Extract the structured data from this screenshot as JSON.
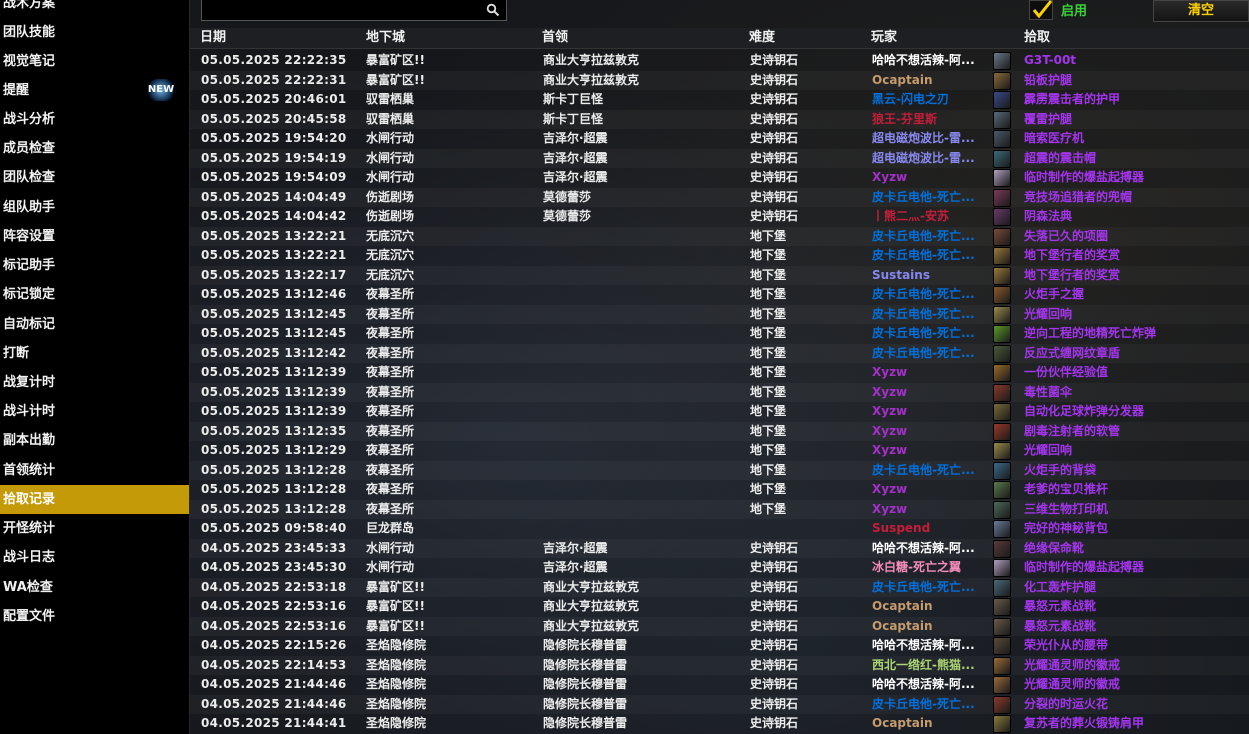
{
  "sidebar": {
    "items": [
      {
        "label": "战术方案"
      },
      {
        "label": "团队技能"
      },
      {
        "label": "视觉笔记"
      },
      {
        "label": "提醒",
        "badge": "NEW"
      },
      {
        "label": "战斗分析"
      },
      {
        "label": "成员检查"
      },
      {
        "label": "团队检查"
      },
      {
        "label": "组队助手"
      },
      {
        "label": "阵容设置"
      },
      {
        "label": "标记助手"
      },
      {
        "label": "标记锁定"
      },
      {
        "label": "自动标记"
      },
      {
        "label": "打断"
      },
      {
        "label": "战复计时"
      },
      {
        "label": "战斗计时"
      },
      {
        "label": "副本出勤"
      },
      {
        "label": "首领统计"
      },
      {
        "label": "拾取记录",
        "active": true
      },
      {
        "label": "开怪统计"
      },
      {
        "label": "战斗日志"
      },
      {
        "label": "WA检查"
      },
      {
        "label": "配置文件"
      }
    ]
  },
  "toolbar": {
    "search_value": "",
    "enable_label": "启用",
    "enabled": true,
    "clear_label": "清空"
  },
  "table": {
    "headers": [
      "日期",
      "地下城",
      "首领",
      "难度",
      "玩家",
      "拾取"
    ],
    "rows": [
      {
        "date": "05.05.2025 22:22:35",
        "dungeon": "暴富矿区!!",
        "boss": "商业大亨拉兹敦克",
        "difficulty": "史诗钥石",
        "player": "哈哈不想活辣-阿...",
        "player_color": "#ffffff",
        "icon_color": "#6b7a8a",
        "loot": "G3T-00t",
        "loot_color": "#a335ee"
      },
      {
        "date": "05.05.2025 22:22:31",
        "dungeon": "暴富矿区!!",
        "boss": "商业大亨拉兹敦克",
        "difficulty": "史诗钥石",
        "player": "Ocaptain",
        "player_color": "#c69b6d",
        "icon_color": "#8a6a3a",
        "loot": "铅板护腿",
        "loot_color": "#a335ee"
      },
      {
        "date": "05.05.2025 20:46:01",
        "dungeon": "驭雷栖巢",
        "boss": "斯卡丁巨怪",
        "difficulty": "史诗钥石",
        "player": "黑云-闪电之刃",
        "player_color": "#0070dd",
        "icon_color": "#3a4a8a",
        "loot": "霹雳震击者的护甲",
        "loot_color": "#a335ee"
      },
      {
        "date": "05.05.2025 20:45:58",
        "dungeon": "驭雷栖巢",
        "boss": "斯卡丁巨怪",
        "difficulty": "史诗钥石",
        "player": "狼王-芬里斯",
        "player_color": "#c41e3a",
        "icon_color": "#5a6a7a",
        "loot": "覆雷护腿",
        "loot_color": "#a335ee"
      },
      {
        "date": "05.05.2025 19:54:20",
        "dungeon": "水闸行动",
        "boss": "吉泽尔·超震",
        "difficulty": "史诗钥石",
        "player": "超电磁炮波比-雷...",
        "player_color": "#8788ee",
        "icon_color": "#4a5a6a",
        "loot": "暗索医疗机",
        "loot_color": "#a335ee"
      },
      {
        "date": "05.05.2025 19:54:19",
        "dungeon": "水闸行动",
        "boss": "吉泽尔·超震",
        "difficulty": "史诗钥石",
        "player": "超电磁炮波比-雷...",
        "player_color": "#8788ee",
        "icon_color": "#3a6a7a",
        "loot": "超震的震击帽",
        "loot_color": "#a335ee"
      },
      {
        "date": "05.05.2025 19:54:09",
        "dungeon": "水闸行动",
        "boss": "吉泽尔·超震",
        "difficulty": "史诗钥石",
        "player": "Xyzw",
        "player_color": "#a330c9",
        "icon_color": "#b0a0c0",
        "loot": "临时制作的爆盐起搏器",
        "loot_color": "#a335ee"
      },
      {
        "date": "05.05.2025 14:04:49",
        "dungeon": "伤逝剧场",
        "boss": "莫德蕾莎",
        "difficulty": "史诗钥石",
        "player": "皮卡丘电他-死亡...",
        "player_color": "#0070dd",
        "icon_color": "#7a3a5a",
        "loot": "竞技场追猎者的兜帽",
        "loot_color": "#a335ee"
      },
      {
        "date": "05.05.2025 14:04:42",
        "dungeon": "伤逝剧场",
        "boss": "莫德蕾莎",
        "difficulty": "史诗钥石",
        "player": "丨熊二灬-安苏",
        "player_color": "#c41e3a",
        "icon_color": "#6a3a6a",
        "loot": "阴森法典",
        "loot_color": "#a335ee"
      },
      {
        "date": "05.05.2025 13:22:21",
        "dungeon": "无底沉穴",
        "boss": "",
        "difficulty": "地下堡",
        "player": "皮卡丘电他-死亡...",
        "player_color": "#0070dd",
        "icon_color": "#7a4a3a",
        "loot": "失落已久的项圈",
        "loot_color": "#a335ee"
      },
      {
        "date": "05.05.2025 13:22:21",
        "dungeon": "无底沉穴",
        "boss": "",
        "difficulty": "地下堡",
        "player": "皮卡丘电他-死亡...",
        "player_color": "#0070dd",
        "icon_color": "#9a7a3a",
        "loot": "地下堡行者的奖赏",
        "loot_color": "#a335ee"
      },
      {
        "date": "05.05.2025 13:22:17",
        "dungeon": "无底沉穴",
        "boss": "",
        "difficulty": "地下堡",
        "player": "Sustains",
        "player_color": "#8788ee",
        "icon_color": "#9a7a3a",
        "loot": "地下堡行者的奖赏",
        "loot_color": "#a335ee"
      },
      {
        "date": "05.05.2025 13:12:46",
        "dungeon": "夜幕圣所",
        "boss": "",
        "difficulty": "地下堡",
        "player": "皮卡丘电他-死亡...",
        "player_color": "#0070dd",
        "icon_color": "#8a5a2a",
        "loot": "火炬手之握",
        "loot_color": "#a335ee"
      },
      {
        "date": "05.05.2025 13:12:45",
        "dungeon": "夜幕圣所",
        "boss": "",
        "difficulty": "地下堡",
        "player": "皮卡丘电他-死亡...",
        "player_color": "#0070dd",
        "icon_color": "#9a8a4a",
        "loot": "光耀回响",
        "loot_color": "#a335ee"
      },
      {
        "date": "05.05.2025 13:12:45",
        "dungeon": "夜幕圣所",
        "boss": "",
        "difficulty": "地下堡",
        "player": "皮卡丘电他-死亡...",
        "player_color": "#0070dd",
        "icon_color": "#5a9a2a",
        "loot": "逆向工程的地精死亡炸弹",
        "loot_color": "#a335ee"
      },
      {
        "date": "05.05.2025 13:12:42",
        "dungeon": "夜幕圣所",
        "boss": "",
        "difficulty": "地下堡",
        "player": "皮卡丘电他-死亡...",
        "player_color": "#0070dd",
        "icon_color": "#4a5a3a",
        "loot": "反应式缠网纹章盾",
        "loot_color": "#a335ee"
      },
      {
        "date": "05.05.2025 13:12:39",
        "dungeon": "夜幕圣所",
        "boss": "",
        "difficulty": "地下堡",
        "player": "Xyzw",
        "player_color": "#a330c9",
        "icon_color": "#9a6a2a",
        "loot": "一份伙伴经验值",
        "loot_color": "#a335ee"
      },
      {
        "date": "05.05.2025 13:12:39",
        "dungeon": "夜幕圣所",
        "boss": "",
        "difficulty": "地下堡",
        "player": "Xyzw",
        "player_color": "#a330c9",
        "icon_color": "#8a3a2a",
        "loot": "毒性菌伞",
        "loot_color": "#a335ee"
      },
      {
        "date": "05.05.2025 13:12:39",
        "dungeon": "夜幕圣所",
        "boss": "",
        "difficulty": "地下堡",
        "player": "Xyzw",
        "player_color": "#a330c9",
        "icon_color": "#7a6a3a",
        "loot": "自动化足球炸弹分发器",
        "loot_color": "#a335ee"
      },
      {
        "date": "05.05.2025 13:12:35",
        "dungeon": "夜幕圣所",
        "boss": "",
        "difficulty": "地下堡",
        "player": "Xyzw",
        "player_color": "#a330c9",
        "icon_color": "#9a3a2a",
        "loot": "剧毒注射者的软管",
        "loot_color": "#a335ee"
      },
      {
        "date": "05.05.2025 13:12:29",
        "dungeon": "夜幕圣所",
        "boss": "",
        "difficulty": "地下堡",
        "player": "Xyzw",
        "player_color": "#a330c9",
        "icon_color": "#9a8a4a",
        "loot": "光耀回响",
        "loot_color": "#a335ee"
      },
      {
        "date": "05.05.2025 13:12:28",
        "dungeon": "夜幕圣所",
        "boss": "",
        "difficulty": "地下堡",
        "player": "皮卡丘电他-死亡...",
        "player_color": "#0070dd",
        "icon_color": "#3a6a8a",
        "loot": "火炬手的背袋",
        "loot_color": "#a335ee"
      },
      {
        "date": "05.05.2025 13:12:28",
        "dungeon": "夜幕圣所",
        "boss": "",
        "difficulty": "地下堡",
        "player": "Xyzw",
        "player_color": "#a330c9",
        "icon_color": "#5a7a4a",
        "loot": "老爹的宝贝推杆",
        "loot_color": "#a335ee"
      },
      {
        "date": "05.05.2025 13:12:28",
        "dungeon": "夜幕圣所",
        "boss": "",
        "difficulty": "地下堡",
        "player": "Xyzw",
        "player_color": "#a330c9",
        "icon_color": "#4a6a5a",
        "loot": "三维生物打印机",
        "loot_color": "#a335ee"
      },
      {
        "date": "05.05.2025 09:58:40",
        "dungeon": "巨龙群岛",
        "boss": "",
        "difficulty": "",
        "player": "Suspend",
        "player_color": "#c41e3a",
        "icon_color": "#6a7a9a",
        "loot": "完好的神秘背包",
        "loot_color": "#a335ee"
      },
      {
        "date": "04.05.2025 23:45:33",
        "dungeon": "水闸行动",
        "boss": "吉泽尔·超震",
        "difficulty": "史诗钥石",
        "player": "哈哈不想活辣-阿...",
        "player_color": "#ffffff",
        "icon_color": "#5a3a3a",
        "loot": "绝缘保命靴",
        "loot_color": "#a335ee"
      },
      {
        "date": "04.05.2025 23:45:30",
        "dungeon": "水闸行动",
        "boss": "吉泽尔·超震",
        "difficulty": "史诗钥石",
        "player": "冰白糖-死亡之翼",
        "player_color": "#f48cba",
        "icon_color": "#b0a0c0",
        "loot": "临时制作的爆盐起搏器",
        "loot_color": "#a335ee"
      },
      {
        "date": "04.05.2025 22:53:18",
        "dungeon": "暴富矿区!!",
        "boss": "商业大亨拉兹敦克",
        "difficulty": "史诗钥石",
        "player": "皮卡丘电他-死亡...",
        "player_color": "#0070dd",
        "icon_color": "#4a6a7a",
        "loot": "化工轰炸护腿",
        "loot_color": "#a335ee"
      },
      {
        "date": "04.05.2025 22:53:16",
        "dungeon": "暴富矿区!!",
        "boss": "商业大亨拉兹敦克",
        "difficulty": "史诗钥石",
        "player": "Ocaptain",
        "player_color": "#c69b6d",
        "icon_color": "#6a5a4a",
        "loot": "暴怒元素战靴",
        "loot_color": "#a335ee"
      },
      {
        "date": "04.05.2025 22:53:16",
        "dungeon": "暴富矿区!!",
        "boss": "商业大亨拉兹敦克",
        "difficulty": "史诗钥石",
        "player": "Ocaptain",
        "player_color": "#c69b6d",
        "icon_color": "#6a5a4a",
        "loot": "暴怒元素战靴",
        "loot_color": "#a335ee"
      },
      {
        "date": "04.05.2025 22:15:26",
        "dungeon": "圣焰隐修院",
        "boss": "隐修院长穆普雷",
        "difficulty": "史诗钥石",
        "player": "哈哈不想活辣-阿...",
        "player_color": "#ffffff",
        "icon_color": "#5a4a3a",
        "loot": "荣光仆从的腰带",
        "loot_color": "#a335ee"
      },
      {
        "date": "04.05.2025 22:14:53",
        "dungeon": "圣焰隐修院",
        "boss": "隐修院长穆普雷",
        "difficulty": "史诗钥石",
        "player": "西北一绺红-熊猫...",
        "player_color": "#abd473",
        "icon_color": "#9a6a3a",
        "loot": "光耀通灵师的徽戒",
        "loot_color": "#a335ee"
      },
      {
        "date": "04.05.2025 21:44:46",
        "dungeon": "圣焰隐修院",
        "boss": "隐修院长穆普雷",
        "difficulty": "史诗钥石",
        "player": "哈哈不想活辣-阿...",
        "player_color": "#ffffff",
        "icon_color": "#9a6a3a",
        "loot": "光耀通灵师的徽戒",
        "loot_color": "#a335ee"
      },
      {
        "date": "04.05.2025 21:44:46",
        "dungeon": "圣焰隐修院",
        "boss": "隐修院长穆普雷",
        "difficulty": "史诗钥石",
        "player": "皮卡丘电他-死亡...",
        "player_color": "#0070dd",
        "icon_color": "#8a3a2a",
        "loot": "分裂的时运火花",
        "loot_color": "#a335ee"
      },
      {
        "date": "04.05.2025 21:44:41",
        "dungeon": "圣焰隐修院",
        "boss": "隐修院长穆普雷",
        "difficulty": "史诗钥石",
        "player": "Ocaptain",
        "player_color": "#c69b6d",
        "icon_color": "#8a7a3a",
        "loot": "复苏者的葬火锻铸肩甲",
        "loot_color": "#a335ee"
      }
    ]
  }
}
